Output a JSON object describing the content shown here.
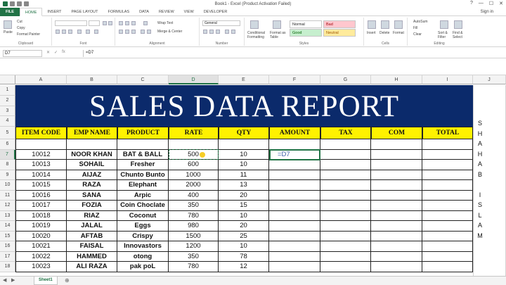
{
  "window": {
    "title": "Book1 - Excel (Product Activation Failed)",
    "controls": [
      "?",
      "—",
      "☐",
      "✕"
    ]
  },
  "ribbon_tabs": [
    "FILE",
    "HOME",
    "INSERT",
    "PAGE LAYOUT",
    "FORMULAS",
    "DATA",
    "REVIEW",
    "VIEW",
    "DEVELOPER"
  ],
  "active_tab": "HOME",
  "signin": "Sign in",
  "ribbon": {
    "clipboard": {
      "label": "Clipboard",
      "paste": "Paste",
      "cut": "Cut",
      "copy": "Copy",
      "format_painter": "Format Painter"
    },
    "font": {
      "label": "Font"
    },
    "alignment": {
      "label": "Alignment",
      "wrap_text": "Wrap Text",
      "merge_center": "Merge & Center"
    },
    "number": {
      "label": "Number",
      "format": "General"
    },
    "styles": {
      "label": "Styles",
      "conditional": "Conditional Formatting",
      "format_table": "Format as Table",
      "normal": "Normal",
      "bad": "Bad",
      "good": "Good",
      "neutral": "Neutral"
    },
    "cells": {
      "label": "Cells",
      "insert": "Insert",
      "delete": "Delete",
      "format": "Format"
    },
    "editing": {
      "label": "Editing",
      "autosum": "AutoSum",
      "fill": "Fill",
      "clear": "Clear",
      "sort_filter": "Sort & Filter",
      "find_select": "Find & Select"
    }
  },
  "formula_bar": {
    "name_box": "D7",
    "formula": "=D7"
  },
  "columns": [
    "A",
    "B",
    "C",
    "D",
    "E",
    "F",
    "G",
    "H",
    "I",
    "J"
  ],
  "rows": [
    "1",
    "2",
    "3",
    "4",
    "5",
    "6",
    "7",
    "8",
    "9",
    "10",
    "11",
    "12",
    "13",
    "14",
    "15",
    "16",
    "17",
    "18"
  ],
  "banner_title": "SALES DATA REPORT",
  "headers": [
    "ITEM CODE",
    "EMP NAME",
    "PRODUCT",
    "RATE",
    "QTY",
    "AMOUNT",
    "TAX",
    "COM",
    "TOTAL"
  ],
  "data_rows": [
    [
      "10012",
      "NOOR KHAN",
      "BAT & BALL",
      "500",
      "10",
      "=D7"
    ],
    [
      "10013",
      "SOHAIL",
      "Fresher",
      "600",
      "10",
      ""
    ],
    [
      "10014",
      "AIJAZ",
      "Chunto Bunto",
      "1000",
      "11",
      ""
    ],
    [
      "10015",
      "RAZA",
      "Elephant",
      "2000",
      "13",
      ""
    ],
    [
      "10016",
      "SANA",
      "Arpic",
      "400",
      "20",
      ""
    ],
    [
      "10017",
      "FOZIA",
      "Coin Choclate",
      "350",
      "15",
      ""
    ],
    [
      "10018",
      "RIAZ",
      "Coconut",
      "780",
      "10",
      ""
    ],
    [
      "10019",
      "JALAL",
      "Eggs",
      "980",
      "20",
      ""
    ],
    [
      "10020",
      "AFTAB",
      "Crispy",
      "1500",
      "25",
      ""
    ],
    [
      "10021",
      "FAISAL",
      "Innovastors",
      "1200",
      "10",
      ""
    ],
    [
      "10022",
      "HAMMED",
      "otong",
      "350",
      "78",
      ""
    ],
    [
      "10023",
      "ALI RAZA",
      "pak poL",
      "780",
      "12",
      ""
    ]
  ],
  "side_letters": [
    "S",
    "H",
    "A",
    "H",
    "A",
    "B",
    "",
    "I",
    "S",
    "L",
    "A",
    "M"
  ],
  "sheet_tab": "Sheet1",
  "colors": {
    "excel_green": "#217346",
    "banner_blue": "#0b2a6b",
    "header_yellow": "#fff200"
  }
}
